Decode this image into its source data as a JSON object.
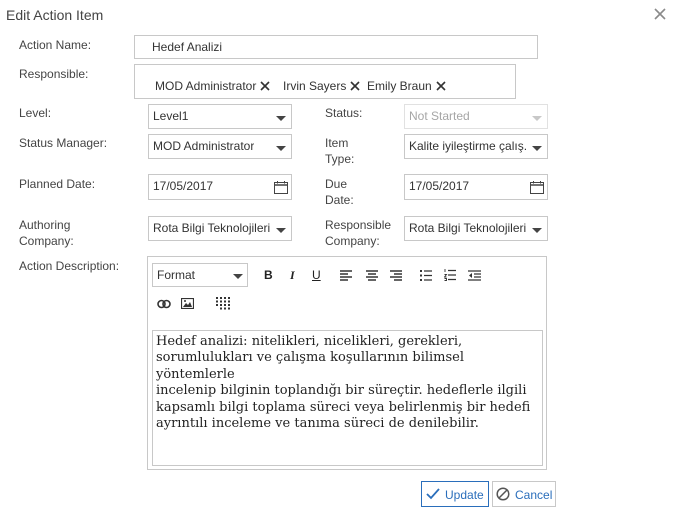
{
  "dialog": {
    "title": "Edit Action Item"
  },
  "form": {
    "action_name": {
      "label": "Action Name:",
      "value": "Hedef Analizi"
    },
    "responsible": {
      "label": "Responsible:",
      "people": [
        "MOD Administrator",
        "Irvin Sayers",
        "Emily Braun"
      ]
    },
    "level": {
      "label": "Level:",
      "value": "Level1"
    },
    "status": {
      "label": "Status:",
      "value": "Not Started"
    },
    "status_manager": {
      "label": "Status Manager:",
      "value": "MOD Administrator"
    },
    "item_type": {
      "label_line1": "Item",
      "label_line2": "Type:",
      "value": "Kalite iyileştirme çalış..."
    },
    "planned_date": {
      "label": "Planned Date:",
      "value": "17/05/2017"
    },
    "due_date": {
      "label_line1": "Due",
      "label_line2": "Date:",
      "value": "17/05/2017"
    },
    "authoring_company": {
      "label_line1": "Authoring",
      "label_line2": "Company:",
      "value": "Rota Bilgi Teknolojileri"
    },
    "responsible_company": {
      "label_line1": "Responsible",
      "label_line2": "Company:",
      "value": "Rota Bilgi Teknolojileri"
    },
    "description": {
      "label": "Action Description:",
      "format_label": "Format",
      "lines": [
        "Hedef analizi: nitelikleri, nicelikleri, gerekleri,",
        "sorumlulukları ve çalışma koşullarının bilimsel yöntemlerle",
        "incelenip bilginin toplandığı bir süreçtir. hedeflerle ilgili",
        "kapsamlı bilgi toplama süreci veya belirlenmiş bir hedefi",
        "ayrıntılı inceleme ve tanıma süreci de denilebilir."
      ]
    }
  },
  "toolbar": {
    "bold": "B",
    "italic": "I",
    "underline": "U"
  },
  "actions": {
    "update_label": "Update",
    "cancel_label": "Cancel"
  }
}
